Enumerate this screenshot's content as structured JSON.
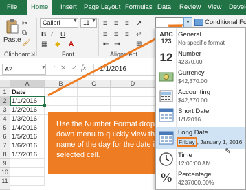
{
  "tabs": [
    "File",
    "Home",
    "Insert",
    "Page Layout",
    "Formulas",
    "Data",
    "Review",
    "View",
    "Develo"
  ],
  "active_tab": "Home",
  "ribbon": {
    "paste_label": "Paste",
    "font_name": "Calibri",
    "font_size": "11",
    "bold": "B",
    "italic": "I",
    "underline": "U",
    "cond_format": "Conditional Form",
    "groups": {
      "clipboard": "Clipboard",
      "font": "Font",
      "alignment": "Alignment"
    }
  },
  "formula_bar": {
    "name_box": "A2",
    "fx": "fx",
    "value": "1/1/2016"
  },
  "sheet": {
    "columns": [
      "A",
      "B",
      "C",
      "D"
    ],
    "rows": [
      {
        "n": "1",
        "a": "Date"
      },
      {
        "n": "2",
        "a": "1/1/2016"
      },
      {
        "n": "3",
        "a": "1/2/2016"
      },
      {
        "n": "4",
        "a": "1/3/2016"
      },
      {
        "n": "5",
        "a": "1/4/2016"
      },
      {
        "n": "6",
        "a": "1/5/2016"
      },
      {
        "n": "7",
        "a": "1/6/2016"
      },
      {
        "n": "8",
        "a": "1/7/2016"
      },
      {
        "n": "9",
        "a": ""
      },
      {
        "n": "10",
        "a": ""
      },
      {
        "n": "11",
        "a": ""
      }
    ]
  },
  "callout": "Use the Number Format drop-down menu to quickly view the name of the day for the date in the selected cell.",
  "formats": [
    {
      "name": "General",
      "example": "No specific format",
      "icon": "ABC 123"
    },
    {
      "name": "Number",
      "example": "42370.00",
      "icon": "12"
    },
    {
      "name": "Currency",
      "example": "$42,370.00",
      "icon": "currency-icon"
    },
    {
      "name": "Accounting",
      "example": " $42,370.00",
      "icon": "accounting-icon"
    },
    {
      "name": "Short Date",
      "example": "1/1/2016",
      "icon": "calendar-icon"
    },
    {
      "name": "Long Date",
      "example_day": "Friday",
      "example_rest": ", January 1, 2016",
      "icon": "calendar-icon"
    },
    {
      "name": "Time",
      "example": "12:00:00 AM",
      "icon": "clock-icon"
    },
    {
      "name": "Percentage",
      "example": "4237000.00%",
      "icon": "%"
    }
  ],
  "colors": {
    "excel_green": "#217346",
    "callout_orange": "#ee7c22",
    "highlight": "#cfe3f5"
  }
}
